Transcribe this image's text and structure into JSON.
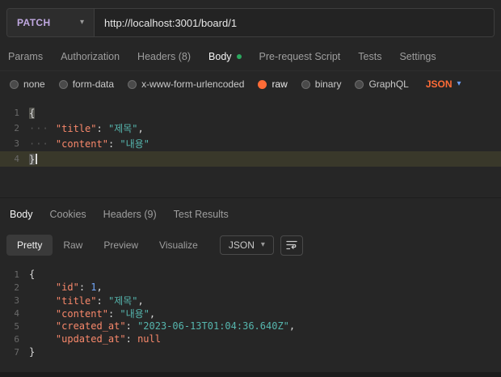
{
  "icons": {
    "chevron_down": "▾"
  },
  "colors": {
    "accent_orange": "#ff6c37",
    "method_patch": "#c0a8e1",
    "active_dot_green": "#2ba95f",
    "json_key": "#f8886b",
    "json_string": "#56b6ae",
    "json_number": "#71a6f9"
  },
  "request": {
    "method": "PATCH",
    "url": "http://localhost:3001/board/1",
    "active_tab": "Body",
    "tabs": [
      {
        "label": "Params"
      },
      {
        "label": "Authorization"
      },
      {
        "label": "Headers (8)"
      },
      {
        "label": "Body"
      },
      {
        "label": "Pre-request Script"
      },
      {
        "label": "Tests"
      },
      {
        "label": "Settings"
      }
    ],
    "body_types": [
      "none",
      "form-data",
      "x-www-form-urlencoded",
      "raw",
      "binary",
      "GraphQL"
    ],
    "selected_body_type": "raw",
    "language": "JSON",
    "code": [
      {
        "num": "1",
        "tokens": [
          {
            "t": "punct",
            "v": "{",
            "bracket": true
          }
        ]
      },
      {
        "num": "2",
        "tokens": [
          {
            "t": "ws",
            "v": "··· "
          },
          {
            "t": "key",
            "v": "\"title\""
          },
          {
            "t": "punct",
            "v": ": "
          },
          {
            "t": "str",
            "v": "\"제목\""
          },
          {
            "t": "punct",
            "v": ","
          }
        ]
      },
      {
        "num": "3",
        "tokens": [
          {
            "t": "ws",
            "v": "··· "
          },
          {
            "t": "key",
            "v": "\"content\""
          },
          {
            "t": "punct",
            "v": ": "
          },
          {
            "t": "str",
            "v": "\"내용\""
          }
        ]
      },
      {
        "num": "4",
        "active": true,
        "cursor": true,
        "tokens": [
          {
            "t": "punct",
            "v": "}",
            "bracket": true
          }
        ]
      }
    ]
  },
  "response": {
    "active_tab": "Body",
    "tabs": [
      {
        "label": "Body"
      },
      {
        "label": "Cookies"
      },
      {
        "label": "Headers (9)"
      },
      {
        "label": "Test Results"
      }
    ],
    "active_view": "Pretty",
    "view_tabs": [
      {
        "label": "Pretty"
      },
      {
        "label": "Raw"
      },
      {
        "label": "Preview"
      },
      {
        "label": "Visualize"
      }
    ],
    "language": "JSON",
    "code": [
      {
        "num": "1",
        "tokens": [
          {
            "t": "punct",
            "v": "{"
          }
        ]
      },
      {
        "num": "2",
        "tokens": [
          {
            "t": "ws",
            "v": "    "
          },
          {
            "t": "key",
            "v": "\"id\""
          },
          {
            "t": "punct",
            "v": ": "
          },
          {
            "t": "num",
            "v": "1"
          },
          {
            "t": "punct",
            "v": ","
          }
        ]
      },
      {
        "num": "3",
        "tokens": [
          {
            "t": "ws",
            "v": "    "
          },
          {
            "t": "key",
            "v": "\"title\""
          },
          {
            "t": "punct",
            "v": ": "
          },
          {
            "t": "str",
            "v": "\"제목\""
          },
          {
            "t": "punct",
            "v": ","
          }
        ]
      },
      {
        "num": "4",
        "tokens": [
          {
            "t": "ws",
            "v": "    "
          },
          {
            "t": "key",
            "v": "\"content\""
          },
          {
            "t": "punct",
            "v": ": "
          },
          {
            "t": "str",
            "v": "\"내용\""
          },
          {
            "t": "punct",
            "v": ","
          }
        ]
      },
      {
        "num": "5",
        "tokens": [
          {
            "t": "ws",
            "v": "    "
          },
          {
            "t": "key",
            "v": "\"created_at\""
          },
          {
            "t": "punct",
            "v": ": "
          },
          {
            "t": "str",
            "v": "\"2023-06-13T01:04:36.640Z\""
          },
          {
            "t": "punct",
            "v": ","
          }
        ]
      },
      {
        "num": "6",
        "tokens": [
          {
            "t": "ws",
            "v": "    "
          },
          {
            "t": "key",
            "v": "\"updated_at\""
          },
          {
            "t": "punct",
            "v": ": "
          },
          {
            "t": "null",
            "v": "null"
          }
        ]
      },
      {
        "num": "7",
        "tokens": [
          {
            "t": "punct",
            "v": "}"
          }
        ]
      }
    ]
  }
}
